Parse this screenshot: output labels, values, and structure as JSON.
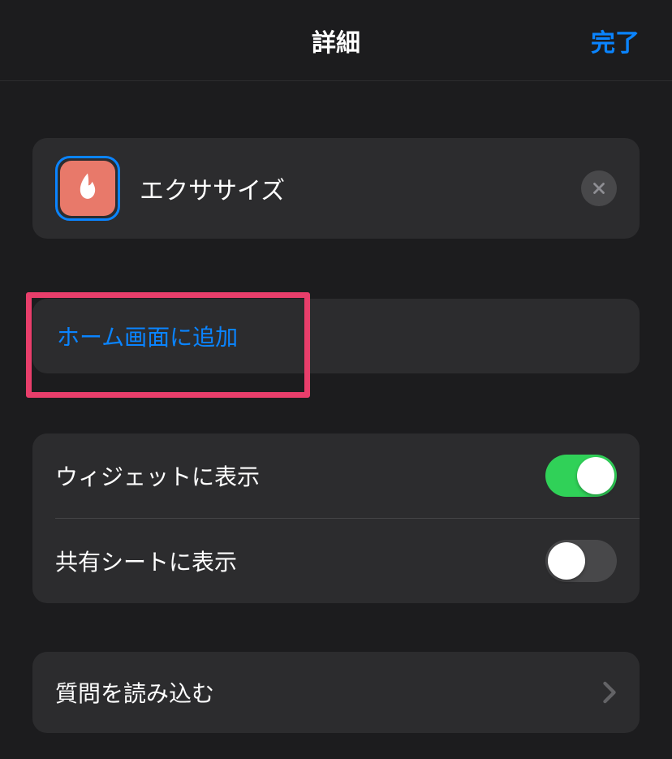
{
  "header": {
    "title": "詳細",
    "done": "完了"
  },
  "shortcut": {
    "name": "エクササイズ",
    "iconName": "flame-icon"
  },
  "actions": {
    "addToHome": "ホーム画面に追加"
  },
  "toggles": {
    "showInWidget": {
      "label": "ウィジェットに表示",
      "value": true
    },
    "showInShareSheet": {
      "label": "共有シートに表示",
      "value": false
    }
  },
  "load": {
    "label": "質問を読み込む"
  }
}
